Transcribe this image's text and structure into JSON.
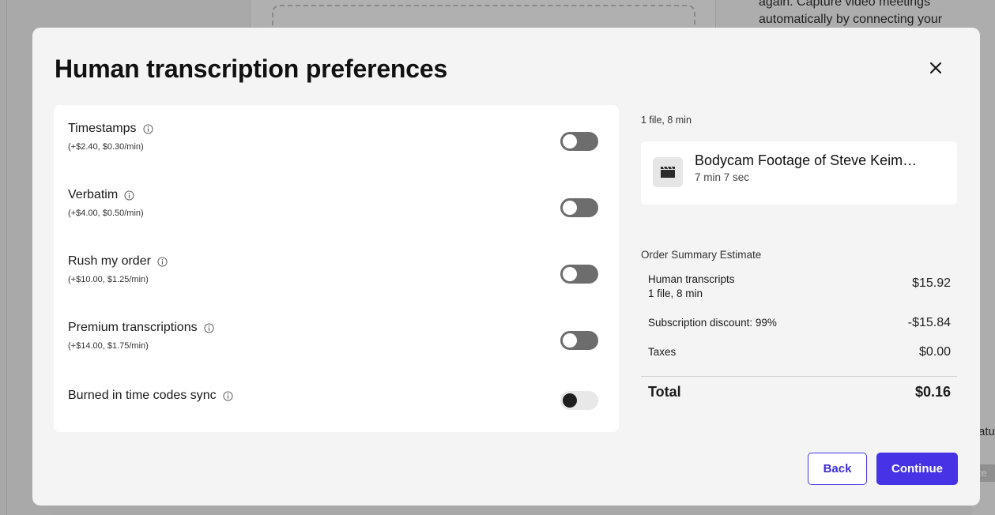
{
  "background": {
    "right_text": "again. Capture video meetings automatically by connecting your",
    "right_fragment_1": "atu",
    "right_fragment_2": "te"
  },
  "modal": {
    "title": "Human transcription preferences",
    "close_icon": "close-icon",
    "options": [
      {
        "label": "Timestamps",
        "price": "(+$2.40, $0.30/min)",
        "enabled": false
      },
      {
        "label": "Verbatim",
        "price": "(+$4.00, $0.50/min)",
        "enabled": false
      },
      {
        "label": "Rush my order",
        "price": "(+$10.00, $1.25/min)",
        "enabled": false
      },
      {
        "label": "Premium transcriptions",
        "price": "(+$14.00, $1.75/min)",
        "enabled": false
      },
      {
        "label": "Burned in time codes sync",
        "price": "",
        "enabled": false
      }
    ],
    "files": {
      "count_label": "1 file, 8 min",
      "items": [
        {
          "name": "Bodycam Footage of Steve Keim…",
          "duration": "7 min 7 sec",
          "icon": "clapperboard-icon"
        }
      ]
    },
    "summary": {
      "heading": "Order Summary Estimate",
      "rows": [
        {
          "label": "Human transcripts",
          "sub": "1 file, 8 min",
          "amount": "$15.92"
        },
        {
          "label": "Subscription discount: 99%",
          "sub": "",
          "amount": "-$15.84"
        },
        {
          "label": "Taxes",
          "sub": "",
          "amount": "$0.00"
        }
      ],
      "total_label": "Total",
      "total_amount": "$0.16"
    },
    "buttons": {
      "back": "Back",
      "continue": "Continue"
    },
    "colors": {
      "accent": "#4733e6",
      "toggle_off": "#6d6d6d"
    }
  }
}
